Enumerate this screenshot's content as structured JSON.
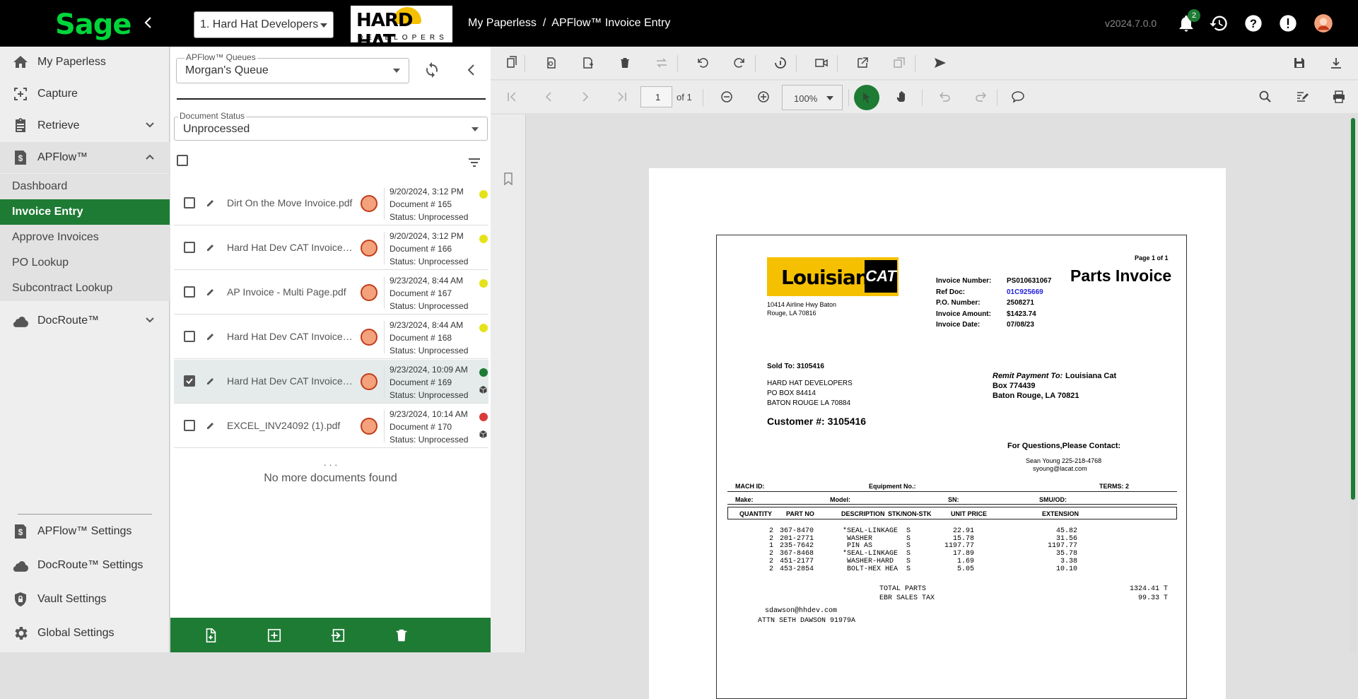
{
  "topbar": {
    "brand": "Sage",
    "company_selected": "1. Hard Hat Developers",
    "company_logo_text": "HARD HAT",
    "company_logo_sub": "DEVELOPERS",
    "breadcrumb": "My Paperless  /  APFlow™ Invoice Entry",
    "version": "v2024.7.0.0",
    "notification_count": "2"
  },
  "sidebar": {
    "items": [
      {
        "label": "My Paperless",
        "icon": "home-icon"
      },
      {
        "label": "Capture",
        "icon": "capture-icon"
      },
      {
        "label": "Retrieve",
        "icon": "clipboard-icon"
      },
      {
        "label": "APFlow™",
        "icon": "dollar-doc-icon"
      },
      {
        "label": "DocRoute™",
        "icon": "cloud-icon"
      }
    ],
    "apflow_sub": [
      "Dashboard",
      "Invoice Entry",
      "Approve Invoices",
      "PO Lookup",
      "Subcontract Lookup"
    ],
    "settings": [
      "APFlow™ Settings",
      "DocRoute™ Settings",
      "Vault Settings",
      "Global Settings"
    ]
  },
  "queue": {
    "queues_label": "APFlow™ Queues",
    "queue_value": "Morgan's Queue",
    "status_label": "Document Status",
    "status_value": "Unprocessed",
    "dots": ". . .",
    "no_more": "No more documents found",
    "documents": [
      {
        "name": "Dirt On the Move Invoice.pdf",
        "date": "9/20/2024, 3:12 PM",
        "doc": "Document # 165",
        "status": "Status: Unprocessed",
        "color": "#e6e21a",
        "checked": false,
        "box": false
      },
      {
        "name": "Hard Hat Dev CAT Invoice.pdf",
        "date": "9/20/2024, 3:12 PM",
        "doc": "Document # 166",
        "status": "Status: Unprocessed",
        "color": "#e6e21a",
        "checked": false,
        "box": false
      },
      {
        "name": "AP Invoice - Multi Page.pdf",
        "date": "9/23/2024, 8:44 AM",
        "doc": "Document # 167",
        "status": "Status: Unprocessed",
        "color": "#e6e21a",
        "checked": false,
        "box": false
      },
      {
        "name": "Hard Hat Dev CAT Invoice.pdf",
        "date": "9/23/2024, 8:44 AM",
        "doc": "Document # 168",
        "status": "Status: Unprocessed",
        "color": "#e6e21a",
        "checked": false,
        "box": false
      },
      {
        "name": "Hard Hat Dev CAT Invoice.pdf",
        "date": "9/23/2024, 10:09 AM",
        "doc": "Document # 169",
        "status": "Status: Unprocessed",
        "color": "#1e7b34",
        "checked": true,
        "box": true
      },
      {
        "name": "EXCEL_INV24092 (1).pdf",
        "date": "9/23/2024, 10:14 AM",
        "doc": "Document # 170",
        "status": "Status: Unprocessed",
        "color": "#d93a3a",
        "checked": false,
        "box": true
      }
    ]
  },
  "viewer": {
    "page_number": "1",
    "page_of": "of 1",
    "zoom": "100%"
  },
  "invoice": {
    "logo_text": "Louisiana",
    "logo_cat": "CAT",
    "page_label": "Page 1 of 1",
    "title": "Parts Invoice",
    "vendor_addr1": "10414 Airline Hwy Baton",
    "vendor_addr2": "Rouge, LA 70816",
    "fields": [
      {
        "label": "Invoice Number:",
        "value": "PS010631067"
      },
      {
        "label": "Ref Doc:",
        "value": "01C925669"
      },
      {
        "label": "P.O. Number:",
        "value": "2508271"
      },
      {
        "label": "Invoice Amount:",
        "value": "$1423.74"
      },
      {
        "label": "Invoice Date:",
        "value": "07/08/23"
      }
    ],
    "sold_to": "Sold To:  3105416",
    "bill_to": [
      "HARD HAT DEVELOPERS",
      "PO BOX 84414",
      "BATON ROUGE LA 70884"
    ],
    "remit_label": "Remit Payment To:",
    "remit_name": "Louisiana Cat",
    "remit_lines": [
      "Box 774439",
      "Baton Rouge, LA 70821"
    ],
    "customer": "Customer #:  3105416",
    "questions": "For Questions,Please Contact:",
    "contact1": "Sean Young 225-218-4768",
    "contact2": "syoung@lacat.com",
    "mach_id": "MACH ID:",
    "equipment_no": "Equipment No.:",
    "terms": "TERMS:   2",
    "make": "Make:",
    "model": "Model:",
    "sn": "SN:",
    "smu": "SMU/OD:",
    "headers": [
      "QUANTITY",
      "PART NO",
      "DESCRIPTION",
      "STK/NON-STK",
      "UNIT PRICE",
      "EXTENSION"
    ],
    "rows": [
      [
        "2",
        "367-8470",
        "*SEAL-LINKAGE",
        "S",
        "22.91",
        "45.82"
      ],
      [
        "2",
        "201-2771",
        " WASHER",
        "S",
        "15.78",
        "31.56"
      ],
      [
        "1",
        "235-7642",
        " PIN AS",
        "S",
        "1197.77",
        "1197.77"
      ],
      [
        "2",
        "367-8468",
        "*SEAL-LINKAGE",
        "S",
        "17.89",
        "35.78"
      ],
      [
        "2",
        "451-2177",
        " WASHER-HARD",
        "S",
        "1.69",
        "3.38"
      ],
      [
        "2",
        "453-2854",
        " BOLT-HEX HEA",
        "S",
        "5.05",
        "10.10"
      ]
    ],
    "total_parts_label": "TOTAL PARTS",
    "total_parts": "1324.41 T",
    "tax_label": "EBR SALES TAX",
    "tax": "99.33 T",
    "email": "sdawson@hhdev.com",
    "attn": "ATTN SETH DAWSON 91979A"
  }
}
